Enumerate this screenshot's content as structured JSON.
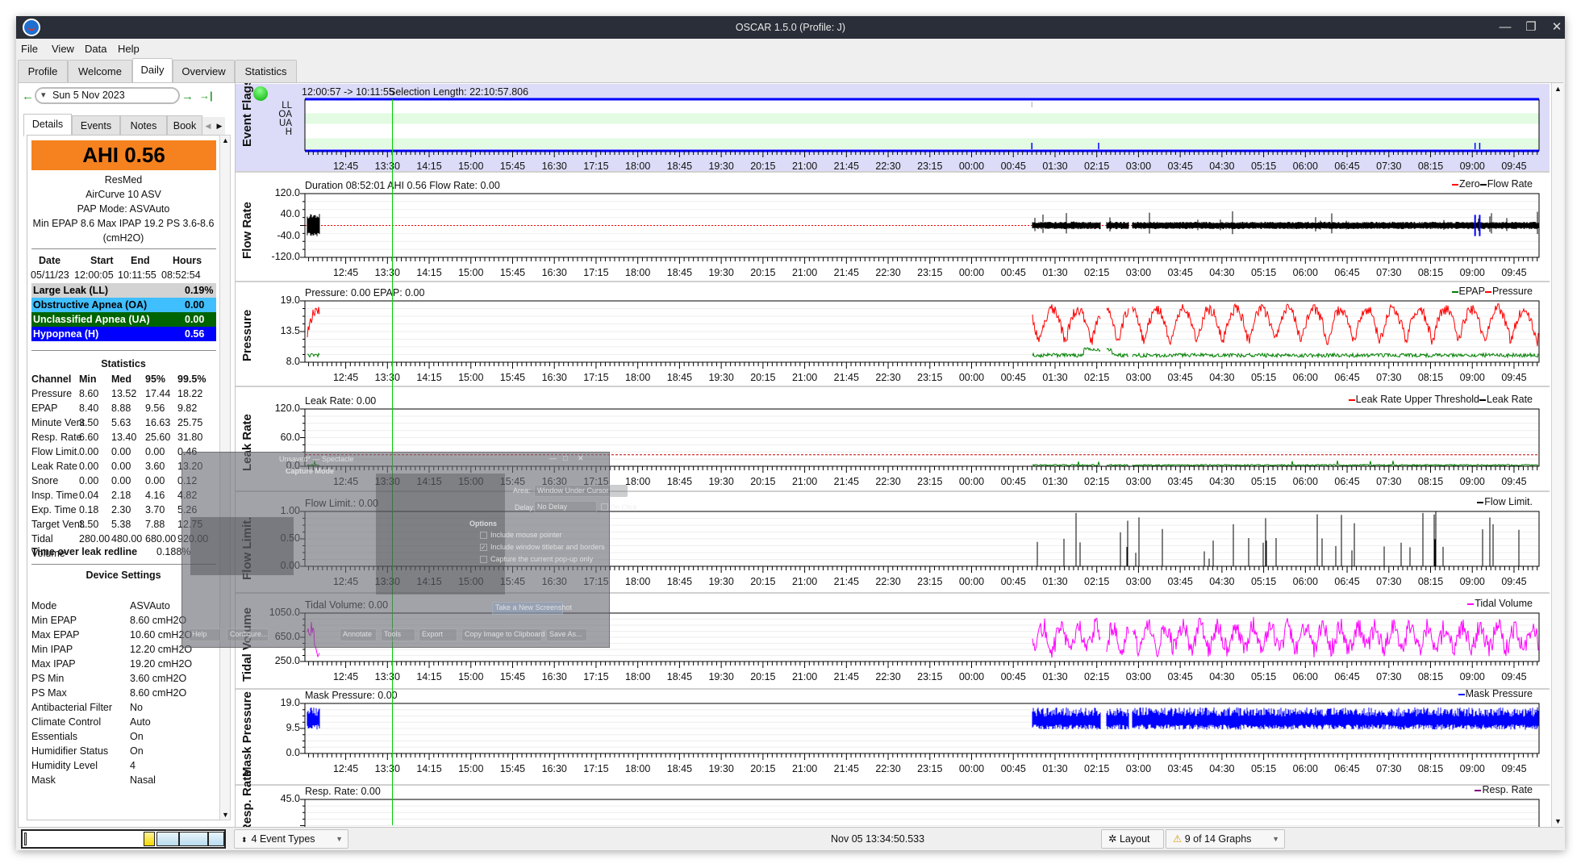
{
  "window": {
    "title": "OSCAR 1.5.0 (Profile: J)",
    "controls": [
      "minimize-icon",
      "restore-icon",
      "close-icon"
    ]
  },
  "menu": [
    "File",
    "View",
    "Data",
    "Help"
  ],
  "tabs": [
    "Profile",
    "Welcome",
    "Daily",
    "Overview",
    "Statistics"
  ],
  "active_tab": "Daily",
  "nav": {
    "date": "Sun 5 Nov 2023",
    "prev_icon": "←",
    "next_icon": "→",
    "last_icon": "→|"
  },
  "subtabs": [
    "Details",
    "Events",
    "Notes",
    "Book"
  ],
  "details": {
    "ahi": "AHI 0.56",
    "ahi_color": "#f5821f",
    "machine": [
      "ResMed",
      "AirCurve 10 ASV",
      "PAP Mode: ASVAuto",
      "Min EPAP 8.6 Max IPAP 19.2 PS 3.6-8.6",
      "(cmH2O)"
    ],
    "session_headers": [
      "Date",
      "Start",
      "End",
      "Hours"
    ],
    "session_row": [
      "05/11/23",
      "12:00:05",
      "10:11:55",
      "08:52:54"
    ],
    "indices": [
      {
        "label": "Large Leak (LL)",
        "value": "0.19%",
        "bg": "#d3d3d3",
        "fg": "#000000"
      },
      {
        "label": "Obstructive Apnea (OA)",
        "value": "0.00",
        "bg": "#40bfff",
        "fg": "#000000"
      },
      {
        "label": "Unclassified Apnea (UA)",
        "value": "0.00",
        "bg": "#006400",
        "fg": "#ffffff"
      },
      {
        "label": "Hypopnea (H)",
        "value": "0.56",
        "bg": "#0000ff",
        "fg": "#ffffff"
      }
    ],
    "stats_title": "Statistics",
    "stats_headers": [
      "Channel",
      "Min",
      "Med",
      "95%",
      "99.5%"
    ],
    "stats_rows": [
      [
        "Pressure",
        "8.60",
        "13.52",
        "17.44",
        "18.22"
      ],
      [
        "EPAP",
        "8.40",
        "8.88",
        "9.56",
        "9.82"
      ],
      [
        "Minute Vent.",
        "3.50",
        "5.63",
        "16.63",
        "25.75"
      ],
      [
        "Resp. Rate",
        "6.60",
        "13.40",
        "25.60",
        "31.80"
      ],
      [
        "Flow Limit.",
        "0.00",
        "0.00",
        "0.00",
        "0.46"
      ],
      [
        "Leak Rate",
        "0.00",
        "0.00",
        "3.60",
        "13.20"
      ],
      [
        "Snore",
        "0.00",
        "0.00",
        "0.00",
        "0.12"
      ],
      [
        "Insp. Time",
        "0.04",
        "2.18",
        "4.16",
        "4.82"
      ],
      [
        "Exp. Time",
        "0.18",
        "2.30",
        "3.70",
        "5.26"
      ],
      [
        "Target Vent.",
        "3.50",
        "5.38",
        "7.88",
        "12.75"
      ],
      [
        "Tidal Volume",
        "280.00",
        "480.00",
        "680.00",
        "920.00"
      ]
    ],
    "leak_redline_label": "Time over leak redline",
    "leak_redline_value": "0.188%",
    "device_title": "Device Settings",
    "device_settings": [
      [
        "Mode",
        "ASVAuto"
      ],
      [
        "Min EPAP",
        "8.60 cmH2O"
      ],
      [
        "Max EPAP",
        "10.60 cmH2O"
      ],
      [
        "Min IPAP",
        "12.20 cmH2O"
      ],
      [
        "Max IPAP",
        "19.20 cmH2O"
      ],
      [
        "PS Min",
        "3.60 cmH2O"
      ],
      [
        "PS Max",
        "8.60 cmH2O"
      ],
      [
        "Antibacterial Filter",
        "No"
      ],
      [
        "Climate Control",
        "Auto"
      ],
      [
        "Essentials",
        "On"
      ],
      [
        "Humidifier Status",
        "On"
      ],
      [
        "Humidity Level",
        "4"
      ],
      [
        "Mask",
        "Nasal"
      ]
    ]
  },
  "event_flags": {
    "title": "Event Flags",
    "range": "12:00:57 -> 10:11:55",
    "selection": "Selection Length: 22:10:57.806",
    "rows": [
      "LL",
      "OA",
      "UA",
      "H"
    ],
    "pin_icon": "pushpin-icon"
  },
  "time_axis": {
    "start": "12:00:57",
    "end": "10:11:55",
    "labels": [
      "12:45",
      "13:30",
      "14:15",
      "15:00",
      "15:45",
      "16:30",
      "17:15",
      "18:00",
      "18:45",
      "19:30",
      "20:15",
      "21:00",
      "21:45",
      "22:30",
      "23:15",
      "00:00",
      "00:45",
      "01:30",
      "02:15",
      "03:00",
      "03:45",
      "04:30",
      "05:15",
      "06:00",
      "06:45",
      "07:30",
      "08:15",
      "09:00",
      "09:45"
    ]
  },
  "cursor_time": "13:34:50",
  "graphs": [
    {
      "id": "flow",
      "title": "Flow Rate",
      "header": "Duration 08:52:01 AHI 0.56 Flow Rate: 0.00",
      "yticks": [
        "120.0",
        "40.0",
        "-40.0",
        "-120.0"
      ],
      "legend": [
        {
          "label": "Zero",
          "color": "#ff0000",
          "dashed": true
        },
        {
          "label": "Flow Rate",
          "color": "#000000"
        }
      ]
    },
    {
      "id": "pressure",
      "title": "Pressure",
      "header": "Pressure: 0.00 EPAP: 0.00",
      "yticks": [
        "19.0",
        "13.5",
        "8.0"
      ],
      "legend": [
        {
          "label": "EPAP",
          "color": "#008000"
        },
        {
          "label": "Pressure",
          "color": "#ff0000"
        }
      ]
    },
    {
      "id": "leak",
      "title": "Leak Rate",
      "header": "Leak Rate: 0.00",
      "yticks": [
        "120.0",
        "60.0",
        "0.0"
      ],
      "legend": [
        {
          "label": "Leak Rate Upper Threshold",
          "color": "#ff0000",
          "dashed": true
        },
        {
          "label": "Leak Rate",
          "color": "#000000"
        }
      ]
    },
    {
      "id": "flowlim",
      "title": "Flow Limit.",
      "header": "Flow Limit.: 0.00",
      "yticks": [
        "1.00",
        "0.50",
        "0.00"
      ],
      "legend": [
        {
          "label": "Flow Limit.",
          "color": "#000000"
        }
      ]
    },
    {
      "id": "tidal",
      "title": "Tidal Volume",
      "header": "Tidal Volume: 0.00",
      "yticks": [
        "1050.0",
        "650.0",
        "250.0"
      ],
      "legend": [
        {
          "label": "Tidal Volume",
          "color": "#ff00ff"
        }
      ]
    },
    {
      "id": "mask",
      "title": "Mask Pressure",
      "header": "Mask Pressure: 0.00",
      "yticks": [
        "19.0",
        "9.5",
        "0.0"
      ],
      "legend": [
        {
          "label": "Mask Pressure",
          "color": "#0000ff"
        }
      ]
    },
    {
      "id": "resp",
      "title": "Resp. Rate",
      "header": "Resp. Rate: 0.00",
      "yticks": [
        "45.0"
      ],
      "legend": [
        {
          "label": "Resp. Rate",
          "color": "#800080"
        }
      ]
    }
  ],
  "statusbar": {
    "event_types": "4 Event Types",
    "time": "Nov 05 13:34:50.533",
    "layout": "Layout",
    "graphs": "9 of 14 Graphs"
  },
  "spectacle": {
    "title": "Unsaved* — Spectacle",
    "capture_mode": "Capture Mode",
    "area_label": "Area:",
    "area_value": "Window Under Cursor",
    "delay_label": "Delay:",
    "delay_value": "No Delay",
    "on_click": "On Click",
    "options": "Options",
    "opt1": "Include mouse pointer",
    "opt2": "Include window titlebar and borders",
    "opt3": "Capture the current pop-up only",
    "opt2_checked": true,
    "take": "Take a New Screenshot",
    "help": "Help",
    "configure": "Configure...",
    "annotate": "Annotate",
    "tools": "Tools",
    "export": "Export",
    "copy": "Copy Image to Clipboard",
    "save": "Save As..."
  }
}
